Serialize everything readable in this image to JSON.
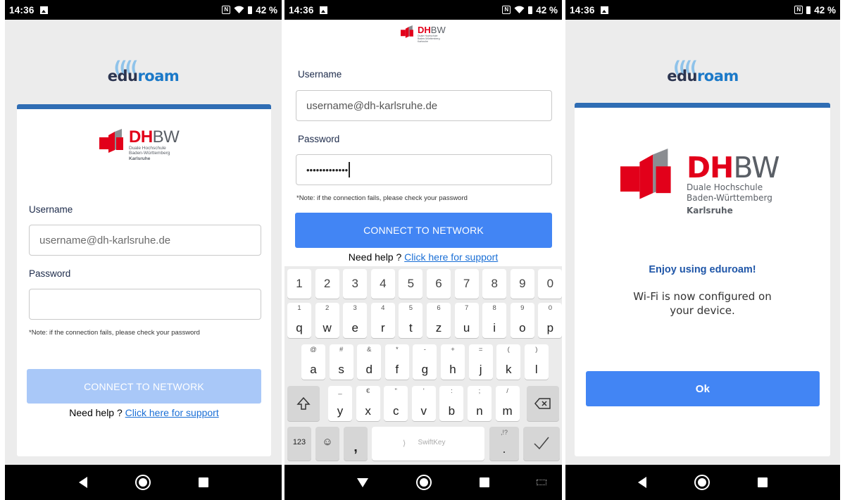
{
  "status": {
    "time": "14:36",
    "battery": "42 %",
    "nfc": "N"
  },
  "eduroam": {
    "prefix": "edu",
    "suffix": "roam",
    "waves": "(((( ",
    "colors": {
      "edu": "#2c3550",
      "roam": "#1b79c8",
      "waves": "#8fc3ea"
    }
  },
  "logo": {
    "dh": "DH",
    "bw": "BW",
    "line1": "Duale Hochschule",
    "line2": "Baden-Württemberg",
    "line3": "Karlsruhe"
  },
  "screen1": {
    "username_label": "Username",
    "username_placeholder": "username@dh-karlsruhe.de",
    "password_label": "Password",
    "password_value": "",
    "note": "*Note: if the connection fails, please check your password",
    "connect": "CONNECT TO NETWORK",
    "help_prefix": "Need help ?",
    "help_link": "Click here for support"
  },
  "screen2": {
    "username_label": "Username",
    "username_value": "username@dh-karlsruhe.de",
    "password_label": "Password",
    "password_value": "•••••••••••••",
    "note": "*Note: if the connection fails, please check your password",
    "connect": "CONNECT TO NETWORK",
    "help_prefix": "Need help ?",
    "help_link": "Click here for support",
    "keyboard": {
      "numbers": [
        "1",
        "2",
        "3",
        "4",
        "5",
        "6",
        "7",
        "8",
        "9",
        "0"
      ],
      "row1": [
        {
          "k": "q",
          "h": "1"
        },
        {
          "k": "w",
          "h": "2"
        },
        {
          "k": "e",
          "h": "3"
        },
        {
          "k": "r",
          "h": "4"
        },
        {
          "k": "t",
          "h": "5"
        },
        {
          "k": "z",
          "h": "6"
        },
        {
          "k": "u",
          "h": "7"
        },
        {
          "k": "i",
          "h": "8"
        },
        {
          "k": "o",
          "h": "9"
        },
        {
          "k": "p",
          "h": "0"
        }
      ],
      "row2": [
        {
          "k": "a",
          "h": "@"
        },
        {
          "k": "s",
          "h": "#"
        },
        {
          "k": "d",
          "h": "&"
        },
        {
          "k": "f",
          "h": "*"
        },
        {
          "k": "g",
          "h": "-"
        },
        {
          "k": "h",
          "h": "+"
        },
        {
          "k": "j",
          "h": "="
        },
        {
          "k": "k",
          "h": "("
        },
        {
          "k": "l",
          "h": ")"
        }
      ],
      "row3": [
        {
          "k": "y",
          "h": "_"
        },
        {
          "k": "x",
          "h": "€"
        },
        {
          "k": "c",
          "h": "\""
        },
        {
          "k": "v",
          "h": "'"
        },
        {
          "k": "b",
          "h": ":"
        },
        {
          "k": "n",
          "h": ";"
        },
        {
          "k": "m",
          "h": "/"
        }
      ],
      "mode_key": "123",
      "emoji_key": "☺",
      "comma_key": ",",
      "space_label": "SwiftKey",
      "period_key": ".",
      "period_hint": ",!?"
    }
  },
  "screen3": {
    "heading": "Enjoy using eduroam!",
    "message_line1": "Wi-Fi is now configured on",
    "message_line2": "your device.",
    "ok": "Ok"
  },
  "colors": {
    "primary": "#4285f4",
    "primary_disabled": "#a9c8f8",
    "card_top": "#2f6db4",
    "dhbw_red": "#e2001a",
    "heading_blue": "#1f56a8"
  }
}
